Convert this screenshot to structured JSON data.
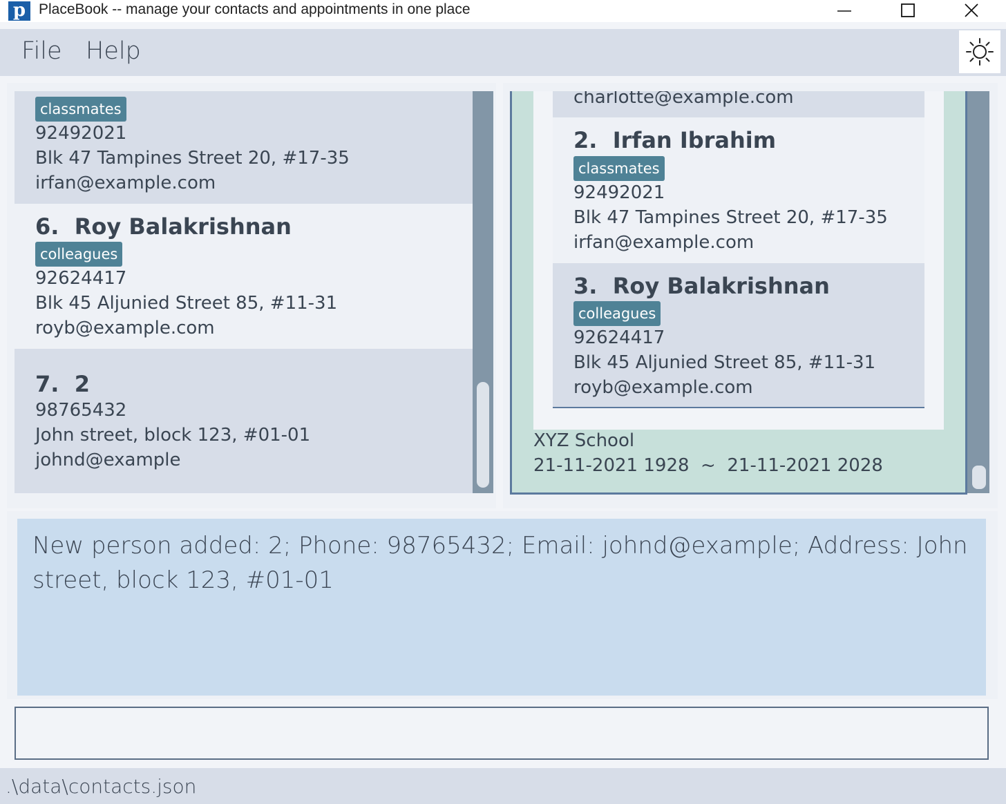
{
  "window": {
    "logo_letter": "p",
    "title": "PlaceBook -- manage your contacts and appointments in one place"
  },
  "menu": {
    "file": "File",
    "help": "Help"
  },
  "persons": [
    {
      "index": "",
      "name": "",
      "tag": "classmates",
      "phone": "92492021",
      "address": "Blk 47 Tampines Street 20, #17-35",
      "email": "irfan@example.com"
    },
    {
      "index": "6.",
      "name": "Roy Balakrishnan",
      "tag": "colleagues",
      "phone": "92624417",
      "address": "Blk 45 Aljunied Street 85, #11-31",
      "email": "royb@example.com"
    },
    {
      "index": "7.",
      "name": "2",
      "tag": "",
      "phone": "98765432",
      "address": "John street, block 123, #01-01",
      "email": "johnd@example"
    }
  ],
  "appointment": {
    "clients": [
      {
        "email": "charlotte@example.com"
      },
      {
        "index": "2.",
        "name": "Irfan Ibrahim",
        "tag": "classmates",
        "phone": "92492021",
        "address": "Blk 47 Tampines Street 20, #17-35",
        "email": "irfan@example.com"
      },
      {
        "index": "3.",
        "name": "Roy Balakrishnan",
        "tag": "colleagues",
        "phone": "92624417",
        "address": "Blk 45 Aljunied Street 85, #11-31",
        "email": "royb@example.com"
      }
    ],
    "location": "XYZ School",
    "time_range": "21-11-2021 1928  ~  21-11-2021 2028"
  },
  "result": {
    "message": "New person added: 2; Phone: 98765432; Email: johnd@example; Address: John street, block 123, #01-01"
  },
  "command": {
    "value": "",
    "placeholder": ""
  },
  "status": {
    "path": ".\\data\\contacts.json"
  },
  "colors": {
    "tag_bg": "#4f8296",
    "appointment_bg": "#c7e0da",
    "result_bg": "#c9dcee",
    "scrollbar": "#8296a7"
  }
}
